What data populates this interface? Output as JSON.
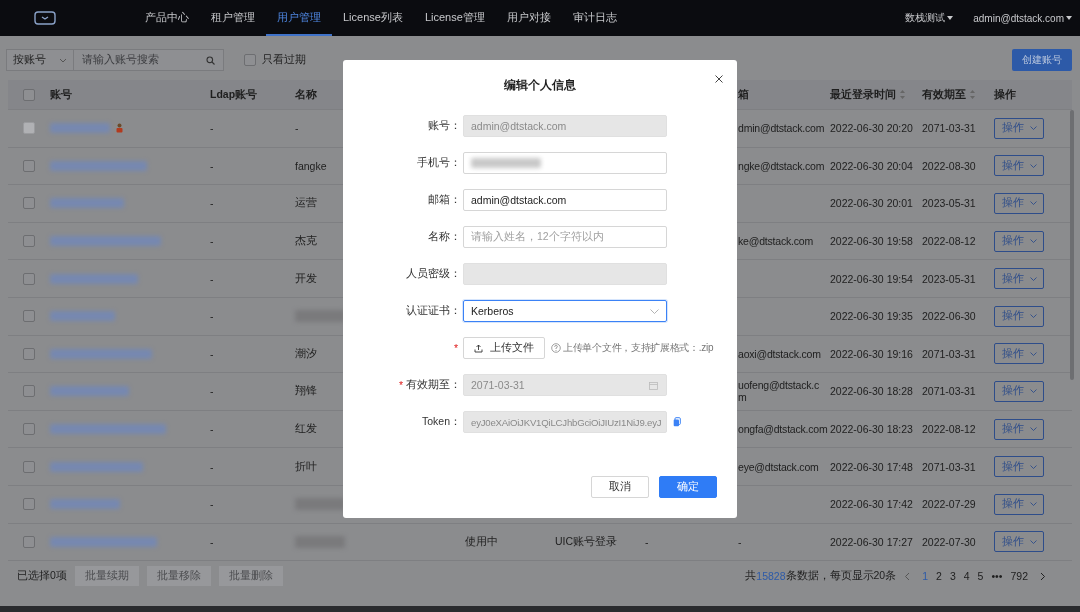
{
  "nav": {
    "items": [
      {
        "label": "产品中心",
        "selected": false
      },
      {
        "label": "租户管理",
        "selected": false
      },
      {
        "label": "用户管理",
        "selected": true
      },
      {
        "label": "License列表",
        "selected": false
      },
      {
        "label": "License管理",
        "selected": false
      },
      {
        "label": "用户对接",
        "selected": false
      },
      {
        "label": "审计日志",
        "selected": false
      }
    ],
    "tenant": "数栈测试",
    "user": "admin@dtstack.com"
  },
  "toolbar": {
    "filter": "按账号",
    "search_placeholder": "请输入账号搜索",
    "expired_only": {
      "label": "只看过期",
      "checked": false
    },
    "create_button": "创建账号"
  },
  "table": {
    "select_all_checked": false,
    "columns": [
      "账号",
      "Ldap账号",
      "名称",
      "箱",
      "最近登录时间",
      "有效期至",
      "操作"
    ],
    "rows": [
      {
        "disabled": true,
        "account_blurred": true,
        "admin_badge": true,
        "ldap": "-",
        "name": "-",
        "email": "dmin@dtstack.com",
        "last_login": "2022-06-30 20:20",
        "expiry": "2071-03-31",
        "action": "操作"
      },
      {
        "disabled": false,
        "account_blurred": true,
        "ldap": "-",
        "name": "fangke",
        "email": "ngke@dtstack.com",
        "last_login": "2022-06-30 20:04",
        "expiry": "2022-08-30",
        "action": "操作"
      },
      {
        "disabled": false,
        "account_blurred": true,
        "ldap": "-",
        "name": "运营",
        "last_login": "2022-06-30 20:01",
        "expiry": "2023-05-31",
        "action": "操作"
      },
      {
        "disabled": false,
        "account_blurred": true,
        "ldap": "-",
        "name": "杰克",
        "email": "ke@dtstack.com",
        "last_login": "2022-06-30 19:58",
        "expiry": "2022-08-12",
        "action": "操作"
      },
      {
        "disabled": false,
        "account_blurred": true,
        "ldap": "-",
        "name": "开发",
        "last_login": "2022-06-30 19:54",
        "expiry": "2023-05-31",
        "action": "操作"
      },
      {
        "disabled": false,
        "account_blurred": true,
        "ldap": "-",
        "name_blurred": true,
        "last_login": "2022-06-30 19:35",
        "expiry": "2022-06-30",
        "action": "操作"
      },
      {
        "disabled": false,
        "account_blurred": true,
        "ldap": "-",
        "name": "潮汐",
        "email": "aoxi@dtstack.com",
        "last_login": "2022-06-30 19:16",
        "expiry": "2071-03-31",
        "action": "操作"
      },
      {
        "disabled": false,
        "account_blurred": true,
        "ldap": "-",
        "name": "翔锋",
        "email": [
          "uofeng@dtstack.c",
          "m"
        ],
        "last_login": "2022-06-30 18:28",
        "expiry": "2071-03-31",
        "action": "操作"
      },
      {
        "disabled": false,
        "account_blurred": true,
        "ldap": "-",
        "name": "红发",
        "email": "ongfa@dtstack.com",
        "last_login": "2022-06-30 18:23",
        "expiry": "2022-08-12",
        "action": "操作"
      },
      {
        "disabled": false,
        "account_blurred": true,
        "ldap": "-",
        "name": "折叶",
        "email": "eye@dtstack.com",
        "last_login": "2022-06-30 17:48",
        "expiry": "2071-03-31",
        "action": "操作"
      },
      {
        "disabled": false,
        "account_blurred": true,
        "ldap": "-",
        "name_blurred": true,
        "last_login": "2022-06-30 17:42",
        "expiry": "2022-07-29",
        "action": "操作"
      },
      {
        "disabled": false,
        "account_blurred": true,
        "ldap": "-",
        "name_blurred": true,
        "status": "使用中",
        "login_type": "UIC账号登录",
        "column_6": "-",
        "email": "-",
        "last_login": "2022-06-30 17:27",
        "expiry": "2022-07-30",
        "action": "操作"
      }
    ]
  },
  "footer": {
    "selected_count": "已选择0项",
    "batch_buttons": [
      "批量续期",
      "批量移除",
      "批量删除"
    ],
    "total_prefix": "共",
    "total": "15828",
    "total_suffix": "条数据，每页显示20条",
    "pages": [
      {
        "label": "1",
        "selected": true
      },
      {
        "label": "2",
        "selected": false
      },
      {
        "label": "3",
        "selected": false
      },
      {
        "label": "4",
        "selected": false
      },
      {
        "label": "5",
        "selected": false
      },
      {
        "label": "•••",
        "selected": false
      },
      {
        "label": "792",
        "selected": false
      }
    ]
  },
  "modal": {
    "title": "编辑个人信息",
    "required_mark": "*",
    "fields": [
      {
        "kind": "input",
        "label": "账号：",
        "value": "admin@dtstack.com",
        "disabled": true
      },
      {
        "kind": "redacted",
        "label": "手机号："
      },
      {
        "kind": "input",
        "label": "邮箱：",
        "value": "admin@dtstack.com",
        "disabled": false
      },
      {
        "kind": "input",
        "label": "名称：",
        "placeholder": "请输入姓名，12个字符以内",
        "disabled": false
      },
      {
        "kind": "input",
        "label": "人员密级：",
        "disabled": true
      },
      {
        "kind": "select",
        "label": "认证证书：",
        "value": "Kerberos"
      },
      {
        "kind": "upload",
        "required": true,
        "button": "上传文件",
        "hint": "上传单个文件，支持扩展格式：.zip"
      },
      {
        "kind": "date",
        "required": true,
        "label": "有效期至：",
        "value": "2071-03-31",
        "disabled": true
      },
      {
        "kind": "token",
        "label": "Token：",
        "value": "eyJ0eXAiOiJKV1QiLCJhbGciOiJIUzI1NiJ9.eyJ",
        "disabled": true
      }
    ],
    "cancel": "取消",
    "ok": "确定"
  }
}
